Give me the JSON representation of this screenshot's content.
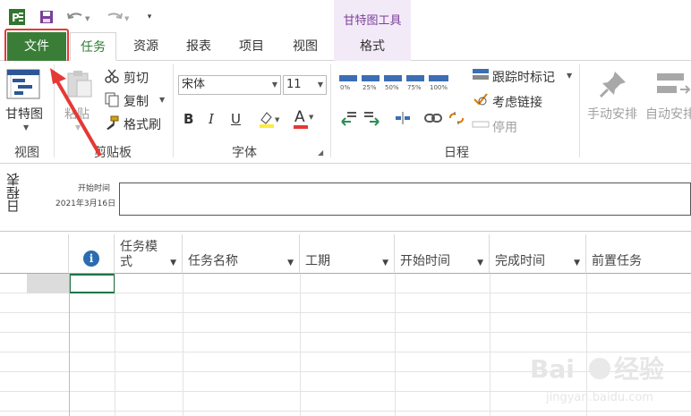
{
  "title_bar": {
    "app_icon": "project-icon",
    "contextual_tab_group": "甘特图工具"
  },
  "tabs": {
    "file": "文件",
    "task": "任务",
    "resource": "资源",
    "report": "报表",
    "project": "项目",
    "view": "视图",
    "format": "格式"
  },
  "ribbon": {
    "view_group": {
      "gantt_label": "甘特图",
      "group_label": "视图"
    },
    "clipboard_group": {
      "paste": "粘贴",
      "cut": "剪切",
      "copy": "复制",
      "format_painter": "格式刷",
      "group_label": "剪贴板"
    },
    "font_group": {
      "font_name": "宋体",
      "font_size": "11",
      "bold": "B",
      "italic": "I",
      "underline": "U",
      "font_color_letter": "A",
      "group_label": "字体"
    },
    "schedule_group": {
      "pct": [
        "0%",
        "25%",
        "50%",
        "75%",
        "100%"
      ],
      "track_mark": "跟踪时标记",
      "respect_links": "考虑链接",
      "inactivate": "停用",
      "group_label": "日程"
    },
    "tasks_group": {
      "manual_schedule": "手动安排",
      "auto_schedule": "自动安排"
    }
  },
  "timeline": {
    "side_label": "日程表",
    "start_label": "开始时间",
    "start_date": "2021年3月16日"
  },
  "grid": {
    "columns": [
      "任务模式",
      "任务名称",
      "工期",
      "开始时间",
      "完成时间",
      "前置任务"
    ]
  },
  "colors": {
    "file_tab": "#3a7d37",
    "accent_green": "#2e7d32",
    "contextual_purple": "#7b3f99",
    "highlight_red": "#e53935"
  }
}
